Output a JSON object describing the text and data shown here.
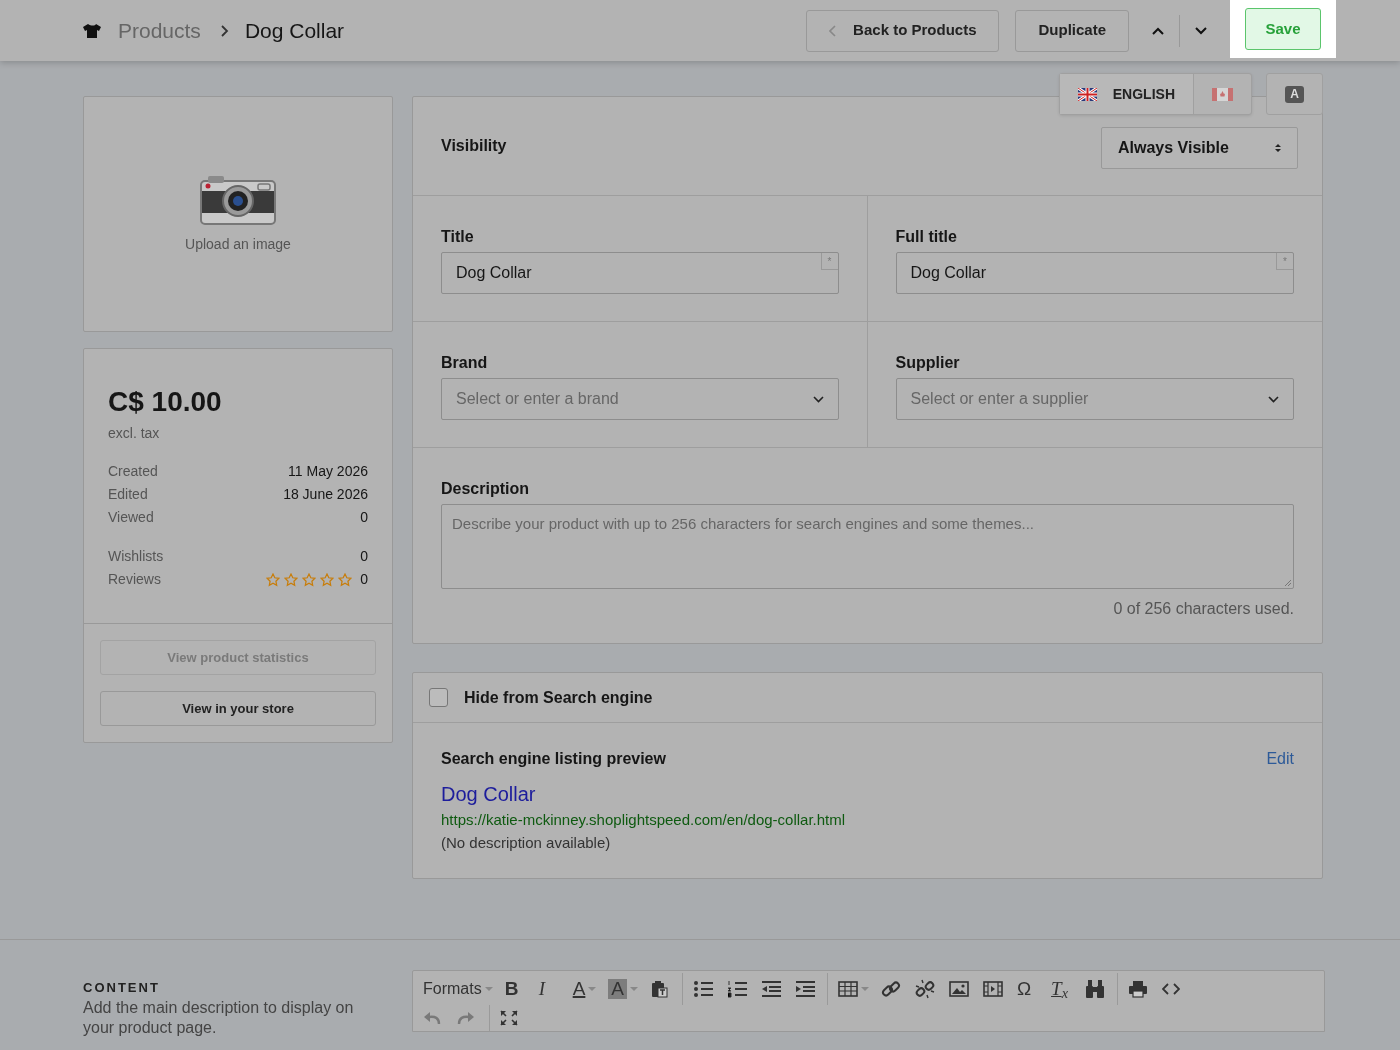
{
  "header": {
    "breadcrumb": [
      {
        "text": "Products",
        "current": false
      },
      {
        "text": "Dog Collar",
        "current": true
      }
    ],
    "buttons": [
      {
        "kind": "back",
        "label": "Back to Products"
      },
      {
        "kind": "plain",
        "label": "Duplicate"
      }
    ],
    "save": {
      "label": "Save",
      "highlighted": true
    }
  },
  "languages": {
    "tabs": [
      {
        "label": "ENGLISH",
        "selected": true
      },
      {
        "selected": false
      }
    ],
    "translate_label": "A"
  },
  "image_upload": {
    "label": "Upload an image"
  },
  "summary": {
    "price": "C$ 10.00",
    "price_note": "excl. tax",
    "stats": [
      {
        "label": "Created",
        "value": "11 May 2026"
      },
      {
        "label": "Edited",
        "value": "18 June 2026"
      },
      {
        "label": "Viewed",
        "value": "0"
      }
    ],
    "engagement": [
      {
        "label": "Wishlists",
        "value": "0"
      },
      {
        "label": "Reviews",
        "stars": 0,
        "value": "0"
      }
    ],
    "actions": [
      {
        "label": "View product statistics",
        "disabled": true
      },
      {
        "label": "View in your store",
        "disabled": false
      }
    ]
  },
  "visibility": {
    "label": "Visibility",
    "value": "Always Visible"
  },
  "fields": [
    {
      "kind": "input",
      "label": "Title",
      "value": "Dog Collar",
      "required_mark": "*"
    },
    {
      "kind": "input",
      "label": "Full title",
      "value": "Dog Collar",
      "required_mark": "*"
    },
    {
      "kind": "combo",
      "label": "Brand",
      "placeholder": "Select or enter a brand"
    },
    {
      "kind": "combo",
      "label": "Supplier",
      "placeholder": "Select or enter a supplier"
    }
  ],
  "description": {
    "label": "Description",
    "placeholder": "Describe your product with up to 256 characters for search engines and some themes...",
    "counter": "0 of 256 characters used."
  },
  "seo": {
    "hide_label": "Hide from Search engine",
    "checked": false,
    "preview_title": "Search engine listing preview",
    "edit": "Edit",
    "result_title": "Dog Collar",
    "result_url": "https://katie-mckinney.shoplightspeed.com/en/dog-collar.html",
    "result_description": "(No description available)"
  },
  "content": {
    "heading": "CONTENT",
    "hint": "Add the main description to display on your product page.",
    "toolbar": [
      [
        [
          {
            "kind": "menu",
            "text": "Formats"
          },
          {
            "kind": "glyph",
            "text": "B"
          },
          {
            "kind": "glyph",
            "text": "I"
          },
          {
            "kind": "glyph",
            "text": "A",
            "has_menu": true
          },
          {
            "kind": "glyph",
            "text": "A",
            "has_menu": true
          },
          {
            "kind": "icon"
          }
        ],
        [
          {
            "kind": "icon"
          },
          {
            "kind": "icon"
          },
          {
            "kind": "icon"
          },
          {
            "kind": "icon"
          }
        ],
        [
          {
            "kind": "icon",
            "has_menu": true
          },
          {
            "kind": "icon"
          },
          {
            "kind": "icon"
          },
          {
            "kind": "icon"
          },
          {
            "kind": "icon"
          },
          {
            "kind": "glyph",
            "text": "Ω"
          },
          {
            "kind": "glyph",
            "text": "T$_{x}$"
          },
          {
            "kind": "icon"
          }
        ],
        [
          {
            "kind": "icon"
          },
          {
            "kind": "icon"
          }
        ]
      ],
      [
        [
          {
            "kind": "icon",
            "disabled": true
          },
          {
            "kind": "icon",
            "disabled": true
          }
        ],
        [
          {
            "kind": "icon"
          }
        ]
      ]
    ]
  }
}
